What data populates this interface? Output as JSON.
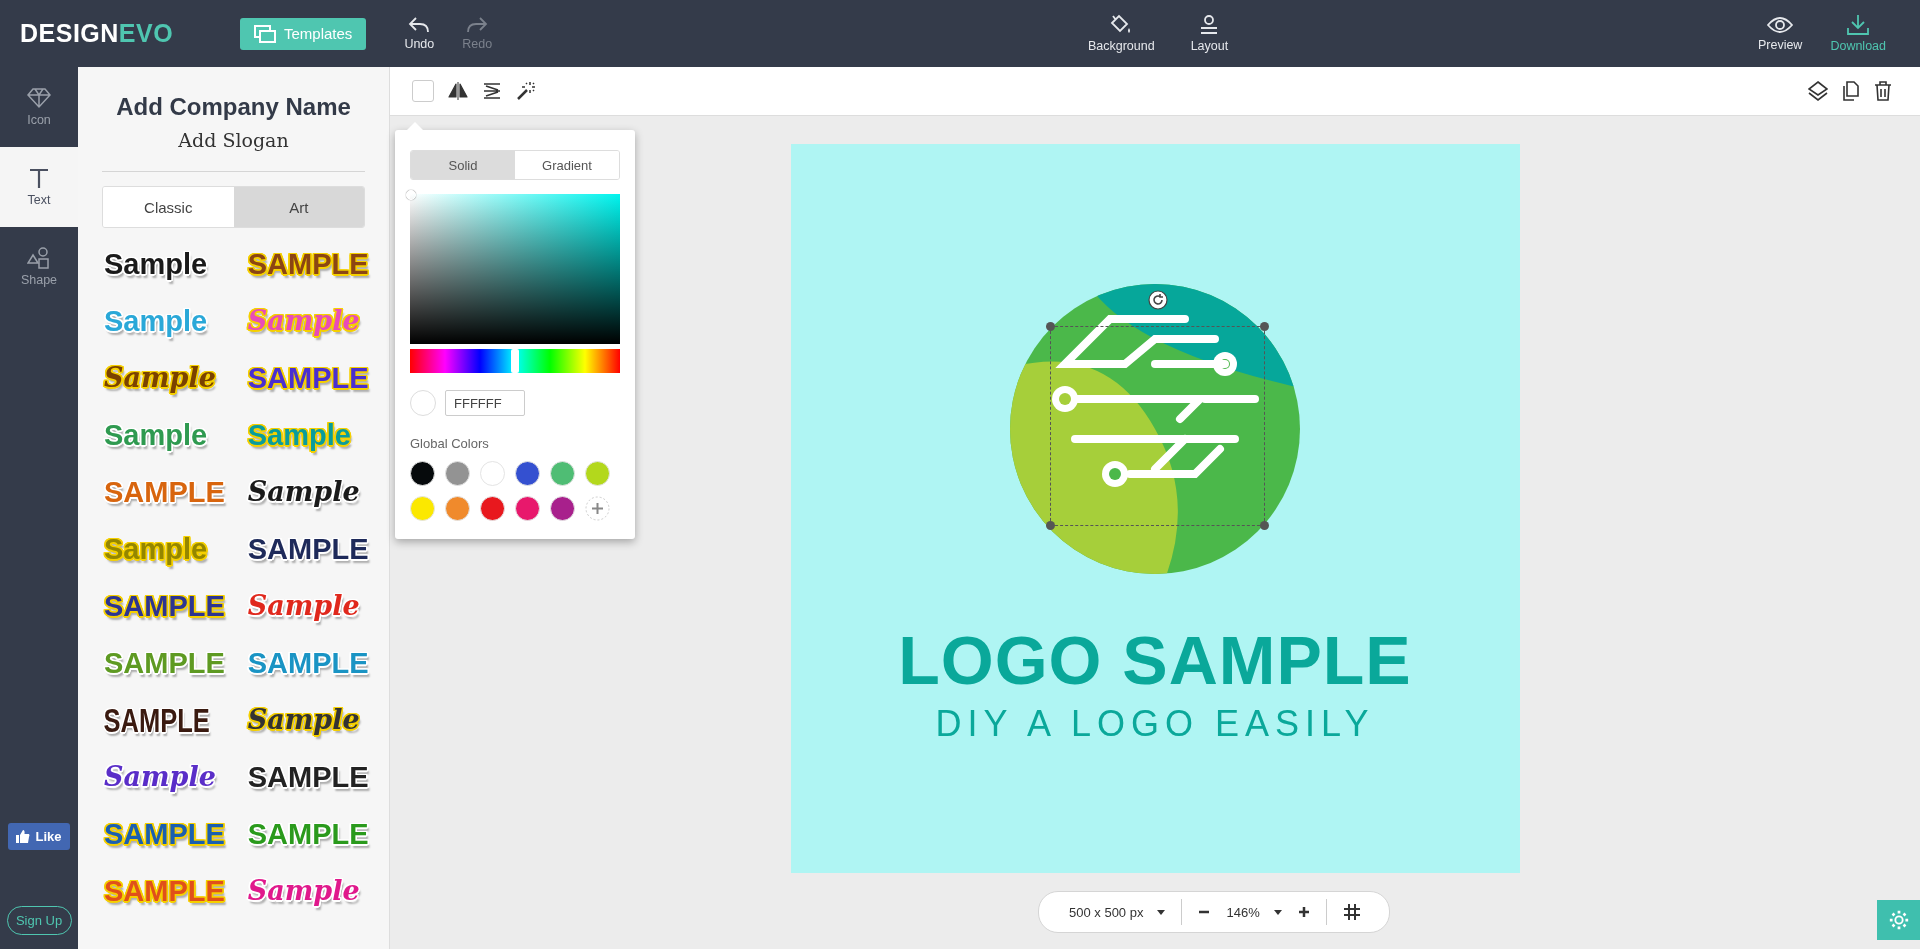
{
  "brand": {
    "name_part_1": "DESIGN",
    "name_part_2": "EVO"
  },
  "top_bar": {
    "templates_button": "Templates",
    "history": [
      {
        "label": "Undo",
        "disabled": false
      },
      {
        "label": "Redo",
        "disabled": true
      }
    ],
    "background": "Background",
    "layout": "Layout",
    "preview": "Preview",
    "download": "Download"
  },
  "rail": {
    "items": [
      {
        "label": "Icon",
        "selected": false
      },
      {
        "label": "Text",
        "selected": true
      },
      {
        "label": "Shape",
        "selected": false
      }
    ],
    "like": "Like",
    "sign_up": "Sign Up"
  },
  "panel": {
    "heading": "Add Company Name",
    "slogan": "Add Slogan",
    "tabs": [
      {
        "label": "Classic",
        "selected": true
      },
      {
        "label": "Art",
        "selected": false
      }
    ],
    "samples": [
      {
        "text": "Sample",
        "kind": "outlined",
        "color": "#1a1a1a"
      },
      {
        "text": "SAMPLE",
        "kind": "filled",
        "color": "#8b4513"
      },
      {
        "text": "Sample",
        "kind": "outlined",
        "color": "#2aa8d8"
      },
      {
        "text": "Sample",
        "kind": "filled-script",
        "color": "#e84cb8"
      },
      {
        "text": "Sample",
        "kind": "filled-script",
        "color": "#7a4200"
      },
      {
        "text": "SAMPLE",
        "kind": "filled",
        "color": "#4a2fd0"
      },
      {
        "text": "Sample",
        "kind": "outlined",
        "color": "#2f9a50"
      },
      {
        "text": "Sample",
        "kind": "filled",
        "color": "#0a9c9c"
      },
      {
        "text": "SAMPLE",
        "kind": "outlined",
        "color": "#d8650e"
      },
      {
        "text": "Sample",
        "kind": "outlined-script",
        "color": "#1a1a1a"
      },
      {
        "text": "Sample",
        "kind": "filled",
        "color": "#948600"
      },
      {
        "text": "SAMPLE",
        "kind": "outlined",
        "color": "#1e2a5a"
      },
      {
        "text": "SAMPLE",
        "kind": "filled",
        "color": "#2d3590"
      },
      {
        "text": "Sample",
        "kind": "outlined-script",
        "color": "#e0281c"
      },
      {
        "text": "SAMPLE",
        "kind": "outlined",
        "color": "#5e9a22"
      },
      {
        "text": "SAMPLE",
        "kind": "outlined",
        "color": "#1a94c4"
      },
      {
        "text": "SAMPLE",
        "kind": "outlined-condensed",
        "color": "#3a1a10"
      },
      {
        "text": "Sample",
        "kind": "filled-script",
        "color": "#333333"
      },
      {
        "text": "Sample",
        "kind": "outlined-script",
        "color": "#5a2ec8"
      },
      {
        "text": "SAMPLE",
        "kind": "outlined",
        "color": "#222222"
      },
      {
        "text": "SAMPLE",
        "kind": "filled",
        "color": "#1a5fb0"
      },
      {
        "text": "SAMPLE",
        "kind": "outlined",
        "color": "#2a9a1c"
      },
      {
        "text": "SAMPLE",
        "kind": "filled",
        "color": "#e0501a"
      },
      {
        "text": "Sample",
        "kind": "outlined-script",
        "color": "#e0198c"
      }
    ]
  },
  "color_picker": {
    "tabs": [
      {
        "label": "Solid",
        "selected": true
      },
      {
        "label": "Gradient",
        "selected": false
      }
    ],
    "hue": {
      "level": 0.5
    },
    "hex": "FFFFFF",
    "global_colors_label": "Global Colors",
    "global_colors": [
      {
        "color": "#060a0c"
      },
      {
        "color": "#939393"
      },
      {
        "color": "#ffffff"
      },
      {
        "color": "#3450d0"
      },
      {
        "color": "#4fbd74"
      },
      {
        "color": "#b3d81c"
      },
      {
        "color": "#fbe800"
      },
      {
        "color": "#f08a2c"
      },
      {
        "color": "#e8181e"
      },
      {
        "color": "#e8186c"
      },
      {
        "color": "#a8208c"
      }
    ]
  },
  "canvas": {
    "title": "LOGO SAMPLE",
    "slogan": "DIY A LOGO EASILY"
  },
  "bottom_bar": {
    "size": "500 x 500 px",
    "zoom": "146%"
  }
}
